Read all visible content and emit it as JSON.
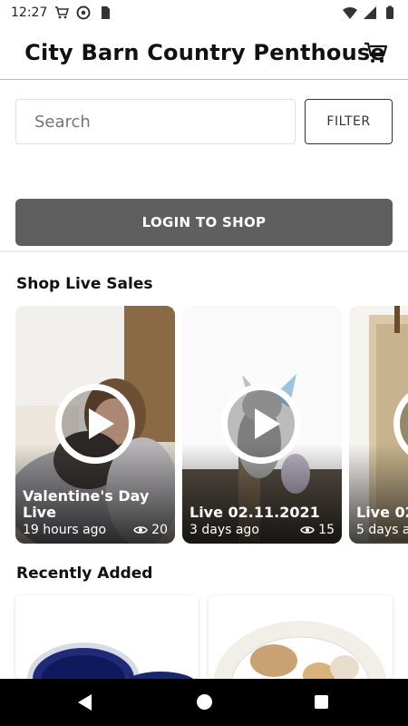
{
  "status_bar": {
    "time": "12:27"
  },
  "header": {
    "title": "City Barn Country Penthouse"
  },
  "search": {
    "placeholder": "Search"
  },
  "filter": {
    "label": "FILTER"
  },
  "login": {
    "label": "LOGIN TO SHOP"
  },
  "sections": {
    "live_title": "Shop Live Sales",
    "recent_title": "Recently Added"
  },
  "live_sales": [
    {
      "title": "Valentine's Day Live",
      "time": "19 hours ago",
      "views": "20"
    },
    {
      "title": "Live 02.11.2021",
      "time": "3 days ago",
      "views": "15"
    },
    {
      "title": "Live 02",
      "time": "5 days a",
      "views": ""
    }
  ],
  "colors": {
    "login_bg": "#5f5f5f",
    "nav_bg": "#000000"
  }
}
